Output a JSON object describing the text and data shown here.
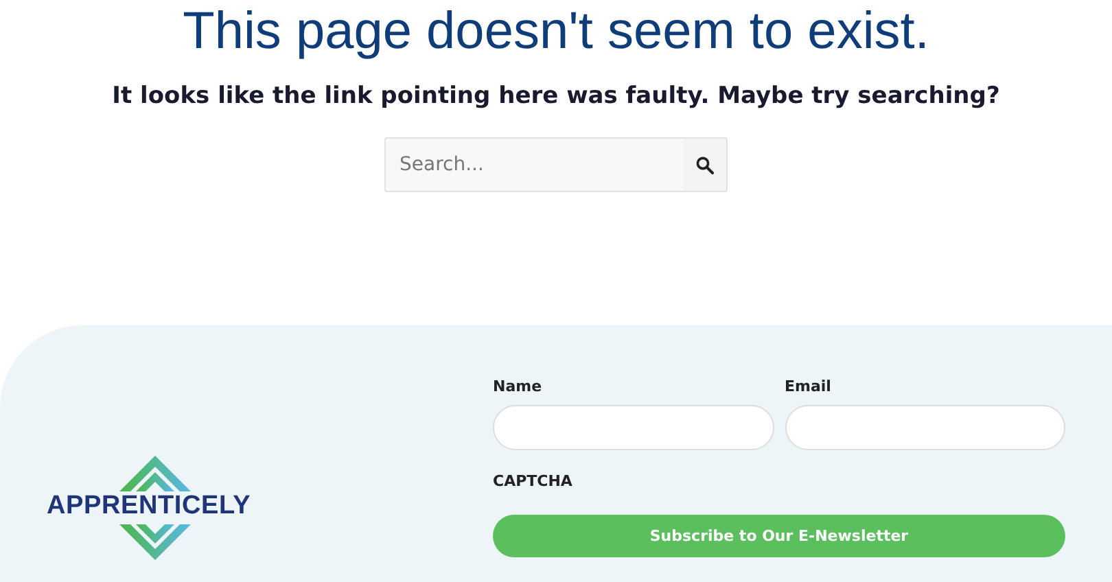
{
  "heading": "This page doesn't seem to exist.",
  "subtitle": "It looks like the link pointing here was faulty. Maybe try searching?",
  "search": {
    "placeholder": "Search..."
  },
  "footer": {
    "logo": "APPRENTICELY",
    "form": {
      "fields": [
        {
          "label": "Name"
        },
        {
          "label": "Email"
        }
      ],
      "captcha": "CAPTCHA",
      "button": "Subscribe to Our E-Newsletter"
    }
  }
}
